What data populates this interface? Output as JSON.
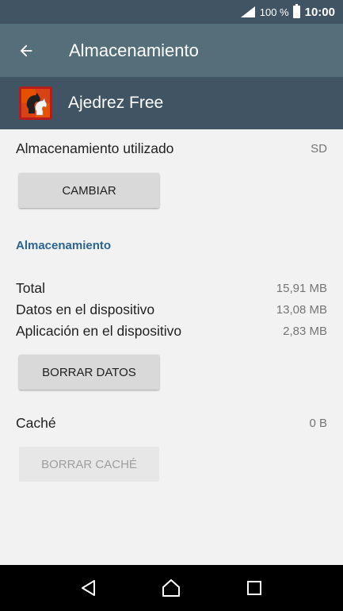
{
  "status_bar": {
    "battery": "100 %",
    "time": "10:00"
  },
  "toolbar": {
    "title": "Almacenamiento"
  },
  "app": {
    "name": "Ajedrez Free"
  },
  "storage_used": {
    "label": "Almacenamiento utilizado",
    "value": "SD",
    "change_button": "CAMBIAR"
  },
  "storage_section": {
    "header": "Almacenamiento",
    "rows": [
      {
        "label": "Total",
        "value": "15,91 MB"
      },
      {
        "label": "Datos en el dispositivo",
        "value": "13,08 MB"
      },
      {
        "label": "Aplicación en el dispositivo",
        "value": "2,83 MB"
      }
    ],
    "clear_data_button": "BORRAR DATOS"
  },
  "cache": {
    "label": "Caché",
    "value": "0 B",
    "clear_cache_button": "BORRAR CACHÉ"
  },
  "icons": {
    "back": "arrow-back-icon",
    "nav_back": "triangle-back-icon",
    "nav_home": "home-icon",
    "nav_recents": "square-recents-icon"
  },
  "colors": {
    "toolbar": "#546e7a",
    "status_bar": "#415463",
    "app_header": "#415463",
    "accent": "#2a6495",
    "background": "#f2f2f2"
  }
}
